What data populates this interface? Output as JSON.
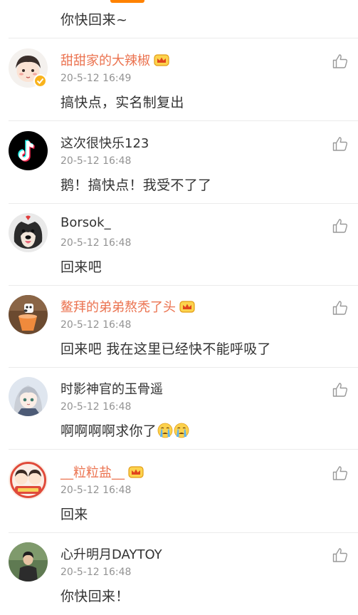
{
  "top_partial_comment": "你快回来~",
  "comments": [
    {
      "name": "甜甜家的大辣椒",
      "vip": true,
      "verified": true,
      "time": "20-5-12 16:49",
      "text": "搞快点，实名制复出",
      "emojis": 0
    },
    {
      "name": "这次很快乐123",
      "vip": false,
      "verified": false,
      "time": "20-5-12 16:48",
      "text": "鹅！搞快点！我受不了了",
      "emojis": 0
    },
    {
      "name": "Borsok_",
      "vip": false,
      "verified": false,
      "time": "20-5-12 16:48",
      "text": "回来吧",
      "emojis": 0
    },
    {
      "name": "鳌拜的弟弟熬秃了头",
      "vip": true,
      "verified": false,
      "time": "20-5-12 16:48",
      "text": "回来吧 我在这里已经快不能呼吸了",
      "emojis": 0
    },
    {
      "name": "时影神官的玉骨遥",
      "vip": false,
      "verified": false,
      "time": "20-5-12 16:48",
      "text": "啊啊啊啊求你了",
      "emojis": 2
    },
    {
      "name": "__粒粒盐__",
      "vip": true,
      "verified": false,
      "time": "20-5-12 16:48",
      "text": "回来",
      "emojis": 0
    },
    {
      "name": "心升明月DAYTOY",
      "vip": false,
      "verified": false,
      "time": "20-5-12 16:48",
      "text": "你快回来！",
      "emojis": 0
    }
  ],
  "colors": {
    "accent": "#ff8200",
    "vip_name": "#eb7350",
    "text": "#333333",
    "meta": "#939393",
    "divider": "#ebebeb"
  },
  "icons": {
    "like": "thumbs-up-icon",
    "vip": "crown-badge-icon",
    "verified": "verified-badge-icon",
    "emoji": "crying-face-emoji"
  }
}
